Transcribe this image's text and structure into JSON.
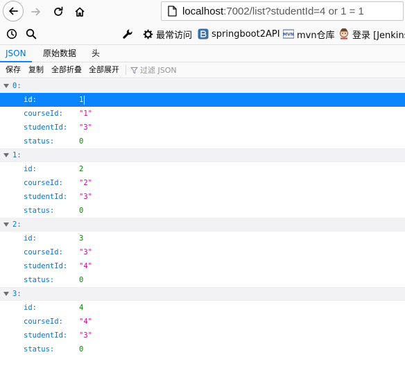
{
  "nav": {
    "url_host": "localhost",
    "url_rest": ":7002/list?studentId=4 or 1 = 1"
  },
  "bookmarks": {
    "items": [
      {
        "label": "最常访问",
        "icon": "gear-icon"
      },
      {
        "label": "springboot2API",
        "icon": "bookmark-favicon-blue"
      },
      {
        "label": "mvn仓库",
        "icon": "mvn-favicon"
      },
      {
        "label": "登录 [Jenkins",
        "icon": "jenkins-favicon"
      }
    ]
  },
  "viewer": {
    "tabs": [
      "JSON",
      "原始数据",
      "头"
    ],
    "toolbar": {
      "save": "保存",
      "copy": "复制",
      "collapse_all": "全部折叠",
      "expand_all": "全部展开",
      "filter_placeholder": "过滤 JSON"
    }
  },
  "json": [
    {
      "index": "0:",
      "fields": [
        {
          "key": "id:",
          "value": "1",
          "type": "num"
        },
        {
          "key": "courseId:",
          "value": "\"1\"",
          "type": "str"
        },
        {
          "key": "studentId:",
          "value": "\"3\"",
          "type": "str"
        },
        {
          "key": "status:",
          "value": "0",
          "type": "num"
        }
      ]
    },
    {
      "index": "1:",
      "fields": [
        {
          "key": "id:",
          "value": "2",
          "type": "num"
        },
        {
          "key": "courseId:",
          "value": "\"2\"",
          "type": "str"
        },
        {
          "key": "studentId:",
          "value": "\"3\"",
          "type": "str"
        },
        {
          "key": "status:",
          "value": "0",
          "type": "num"
        }
      ]
    },
    {
      "index": "2:",
      "fields": [
        {
          "key": "id:",
          "value": "3",
          "type": "num"
        },
        {
          "key": "courseId:",
          "value": "\"3\"",
          "type": "str"
        },
        {
          "key": "studentId:",
          "value": "\"4\"",
          "type": "str"
        },
        {
          "key": "status:",
          "value": "0",
          "type": "num"
        }
      ]
    },
    {
      "index": "3:",
      "fields": [
        {
          "key": "id:",
          "value": "4",
          "type": "num"
        },
        {
          "key": "courseId:",
          "value": "\"4\"",
          "type": "str"
        },
        {
          "key": "studentId:",
          "value": "\"3\"",
          "type": "str"
        },
        {
          "key": "status:",
          "value": "0",
          "type": "num"
        }
      ]
    }
  ],
  "colors": {
    "accent": "#0a84ff",
    "key": "#0074e8",
    "number": "#058b00",
    "string": "#dd00a9"
  }
}
